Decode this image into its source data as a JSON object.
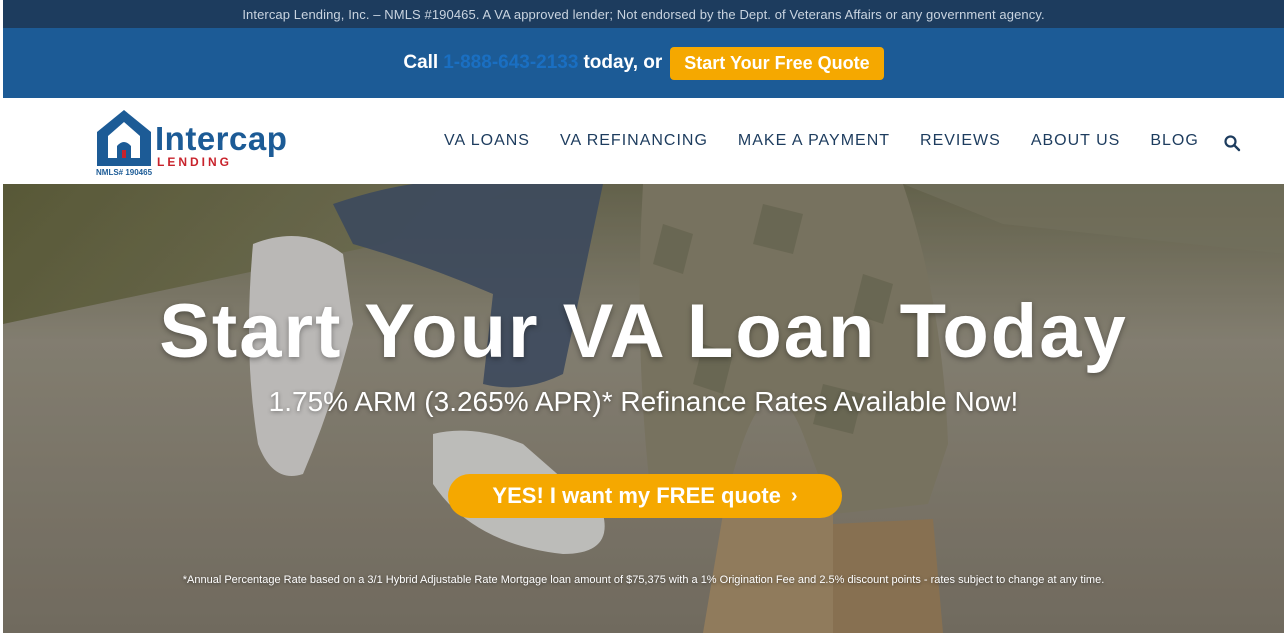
{
  "top_bar": {
    "disclaimer": "Intercap Lending, Inc. – NMLS #190465. A VA approved lender; Not endorsed by the Dept. of Veterans Affairs or any government agency."
  },
  "cta_bar": {
    "call_label": "Call",
    "phone": "1-888-643-2133",
    "after_phone": "today, or",
    "quote_button": "Start Your Free Quote"
  },
  "logo": {
    "name": "Intercap",
    "sub": "LENDING",
    "nmls": "NMLS# 190465"
  },
  "nav": {
    "items": [
      {
        "label": "VA LOANS"
      },
      {
        "label": "VA REFINANCING"
      },
      {
        "label": "MAKE A PAYMENT"
      },
      {
        "label": "REVIEWS"
      },
      {
        "label": "ABOUT US"
      },
      {
        "label": "BLOG"
      }
    ],
    "search_icon": "search-icon"
  },
  "hero": {
    "title": "Start Your VA Loan Today",
    "subtitle": "1.75% ARM (3.265% APR)* Refinance Rates Available Now!",
    "button": "YES! I want my FREE quote",
    "button_icon": "chevron-right-icon",
    "footnote": "*Annual Percentage Rate based on a 3/1 Hybrid Adjustable Rate Mortgage loan amount of $75,375 with a 1% Origination Fee and 2.5% discount points - rates subject to change at any time."
  },
  "colors": {
    "dark_navy": "#1d3c5e",
    "brand_blue": "#1c5b96",
    "accent_orange": "#f5a800",
    "logo_red": "#c8232c"
  }
}
